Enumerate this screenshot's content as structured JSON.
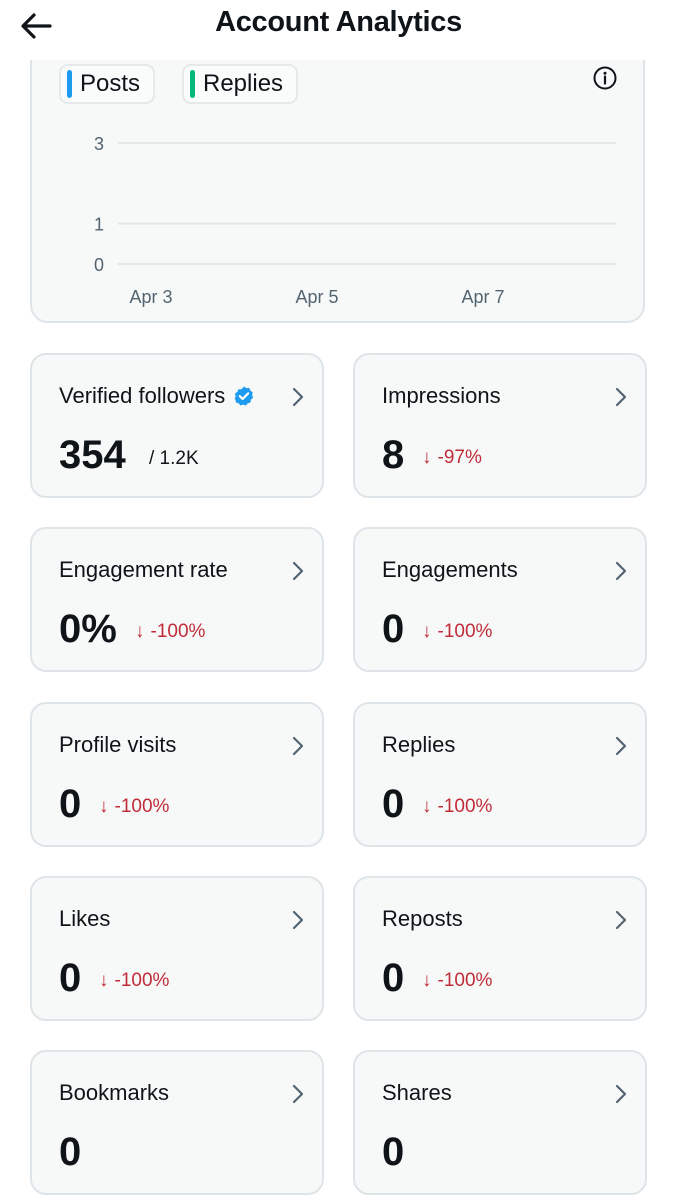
{
  "header": {
    "title": "Account Analytics",
    "back_icon": "arrow-left-icon"
  },
  "chart": {
    "legend": [
      {
        "label": "Posts",
        "color": "#1d9bf0"
      },
      {
        "label": "Replies",
        "color": "#00ba7c"
      }
    ],
    "info_icon": "info-icon"
  },
  "chart_data": {
    "type": "line",
    "x": [
      "Apr 3",
      "Apr 5",
      "Apr 7"
    ],
    "y_ticks": [
      0,
      1,
      3
    ],
    "ylim": [
      0,
      3
    ],
    "series": [
      {
        "name": "Posts",
        "values": []
      },
      {
        "name": "Replies",
        "values": []
      }
    ],
    "grid": true
  },
  "metrics": [
    {
      "label": "Verified followers",
      "value": "354",
      "sub": "/ 1.2K",
      "verified": true
    },
    {
      "label": "Impressions",
      "value": "8",
      "change": "-97%"
    },
    {
      "label": "Engagement rate",
      "value": "0%",
      "change": "-100%"
    },
    {
      "label": "Engagements",
      "value": "0",
      "change": "-100%"
    },
    {
      "label": "Profile visits",
      "value": "0",
      "change": "-100%"
    },
    {
      "label": "Replies",
      "value": "0",
      "change": "-100%"
    },
    {
      "label": "Likes",
      "value": "0",
      "change": "-100%"
    },
    {
      "label": "Reposts",
      "value": "0",
      "change": "-100%"
    },
    {
      "label": "Bookmarks",
      "value": "0"
    },
    {
      "label": "Shares",
      "value": "0"
    }
  ],
  "colors": {
    "negative": "#c02b38",
    "verified": "#1d9bf0",
    "card_bg": "#f7f9f9",
    "card_border": "#dfe4e8"
  }
}
